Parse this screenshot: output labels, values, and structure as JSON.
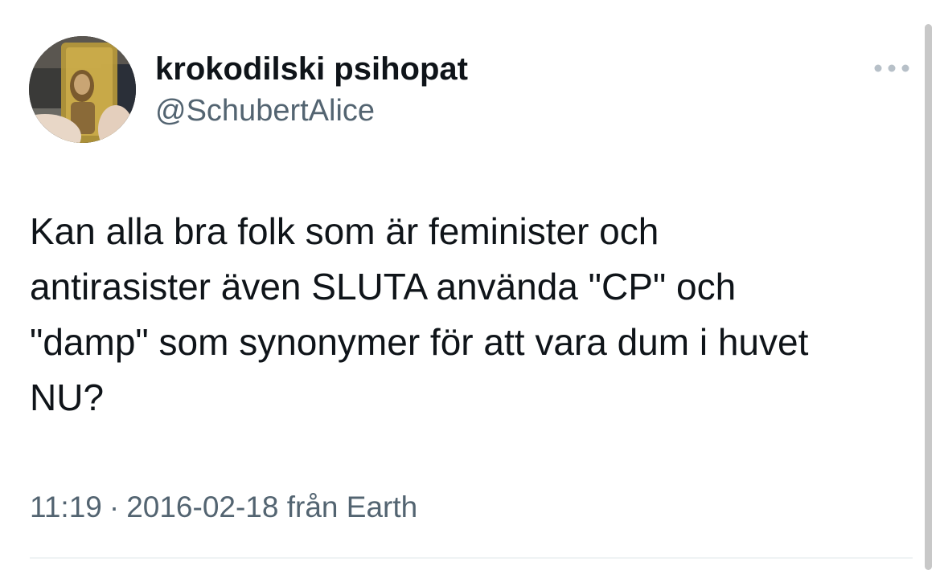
{
  "tweet": {
    "display_name": "krokodilski psihopat",
    "handle": "@SchubertAlice",
    "more_icon": "ellipsis-icon",
    "text": "Kan alla bra folk som är feminister och\nantirasister även SLUTA använda \"CP\"  och\n\"damp\" som synonymer för att vara dum i huvet\nNU?",
    "time": "11:19",
    "date": "2016-02-18",
    "source": "från Earth"
  },
  "colors": {
    "text_primary": "#0f1419",
    "text_secondary": "#536471",
    "divider": "#eff3f4"
  }
}
